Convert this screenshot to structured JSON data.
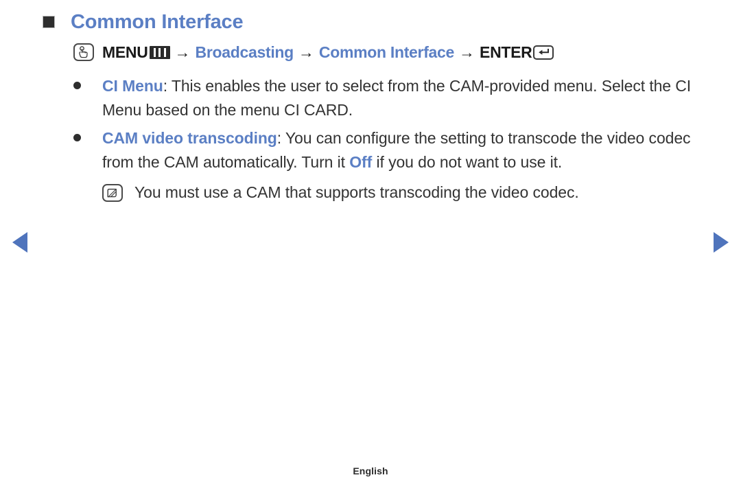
{
  "page": {
    "title": "Common Interface",
    "title_bullet_icon": "filled-square-icon"
  },
  "path": {
    "touch_icon": "hand-press-icon",
    "menu_label": "MENU",
    "menu_glyph_icon": "menu-button-icon",
    "separator": "→",
    "step2": "Broadcasting",
    "step3": "Common Interface",
    "enter_label": "ENTER",
    "enter_glyph_icon": "enter-key-icon"
  },
  "bullets": [
    {
      "icon": "bullet-dot-icon",
      "term": "CI Menu",
      "text_after_term": ": This enables the user to select from the CAM-provided menu. Select the CI Menu based on the menu CI CARD."
    },
    {
      "icon": "bullet-dot-icon",
      "term": "CAM video transcoding",
      "text_part1": ": You can configure the setting to transcode the video codec from the CAM automatically. Turn it ",
      "highlight": "Off",
      "text_part2": " if you do not want to use it."
    }
  ],
  "note": {
    "icon": "note-pencil-icon",
    "text": "You must use a CAM that supports transcoding the video codec."
  },
  "navigation": {
    "prev_icon": "triangle-left-icon",
    "next_icon": "triangle-right-icon"
  },
  "footer": {
    "language": "English"
  },
  "colors": {
    "accent_blue": "#5b7fc4",
    "nav_blue": "#4f74bc",
    "body_text": "#333333"
  }
}
